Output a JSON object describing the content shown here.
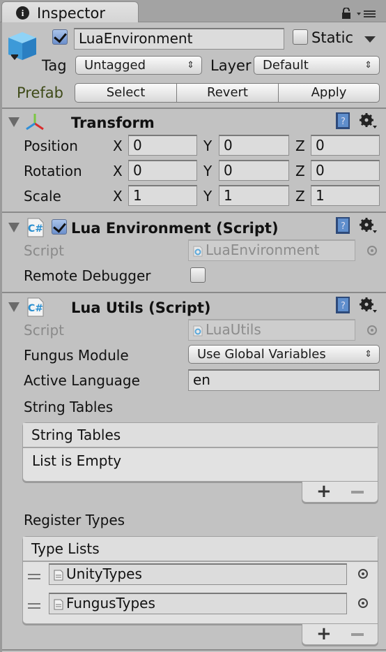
{
  "tab": {
    "icon": "info-icon",
    "label": "Inspector",
    "lock_icon": "lock-icon",
    "menu_icon": "tab-menu-icon"
  },
  "gameobject": {
    "icon": "gameobject-cube-icon",
    "active": true,
    "name": "LuaEnvironment",
    "static_checked": false,
    "static_label": "Static",
    "tag_label": "Tag",
    "tag_value": "Untagged",
    "layer_label": "Layer",
    "layer_value": "Default",
    "prefab_label": "Prefab",
    "prefab_buttons": {
      "select": "Select",
      "revert": "Revert",
      "apply": "Apply"
    }
  },
  "transform": {
    "title": "Transform",
    "expanded": true,
    "rows": [
      {
        "label": "Position",
        "x": "0",
        "y": "0",
        "z": "0"
      },
      {
        "label": "Rotation",
        "x": "0",
        "y": "0",
        "z": "0"
      },
      {
        "label": "Scale",
        "x": "1",
        "y": "1",
        "z": "1"
      }
    ],
    "axes": {
      "x": "X",
      "y": "Y",
      "z": "Z"
    }
  },
  "lua_environment": {
    "title": "Lua Environment (Script)",
    "enabled": true,
    "script_label": "Script",
    "script_value": "LuaEnvironment",
    "remote_debugger_label": "Remote Debugger",
    "remote_debugger_checked": false
  },
  "lua_utils": {
    "title": "Lua Utils (Script)",
    "script_label": "Script",
    "script_value": "LuaUtils",
    "fungus_module_label": "Fungus Module",
    "fungus_module_value": "Use Global Variables",
    "active_language_label": "Active Language",
    "active_language_value": "en",
    "string_tables_label": "String Tables",
    "string_tables_list": {
      "header": "String Tables",
      "empty_text": "List is Empty"
    },
    "register_types_label": "Register Types",
    "type_lists": {
      "header": "Type Lists",
      "items": [
        "UnityTypes",
        "FungusTypes"
      ]
    },
    "add_label": "+"
  }
}
